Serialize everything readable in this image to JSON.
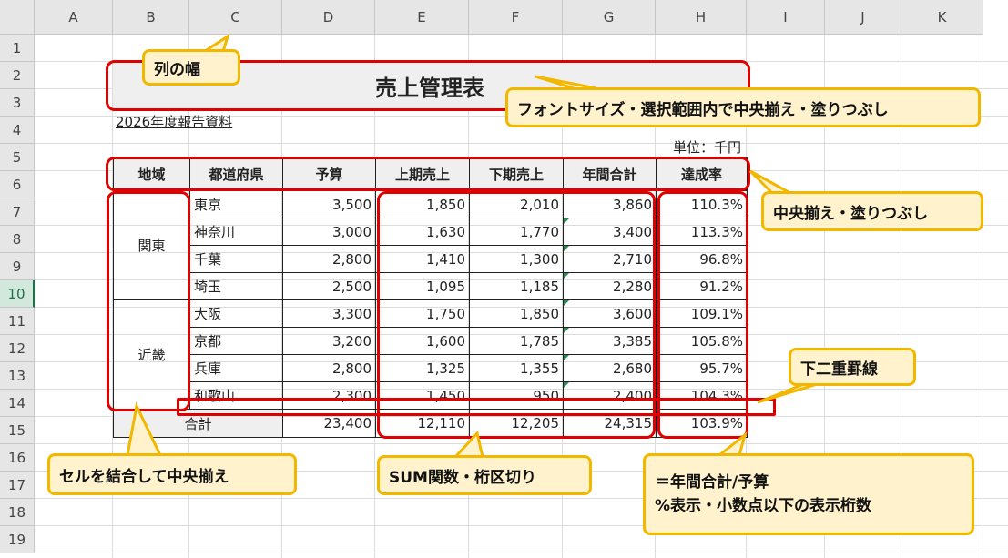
{
  "columns": [
    "A",
    "B",
    "C",
    "D",
    "E",
    "F",
    "G",
    "H",
    "I",
    "J",
    "K"
  ],
  "rows": [
    "1",
    "2",
    "3",
    "4",
    "5",
    "6",
    "7",
    "8",
    "9",
    "10",
    "11",
    "12",
    "13",
    "14",
    "15",
    "16",
    "17",
    "18",
    "19"
  ],
  "selected_row": "10",
  "sheet": {
    "title": "売上管理表",
    "subtitle": "2026年度報告資料",
    "unit": "単位：千円",
    "headers": [
      "地域",
      "都道府県",
      "予算",
      "上期売上",
      "下期売上",
      "年間合計",
      "達成率"
    ],
    "regions": [
      "関東",
      "近畿"
    ],
    "data": [
      [
        "東京",
        "3,500",
        "1,850",
        "2,010",
        "3,860",
        "110.3%"
      ],
      [
        "神奈川",
        "3,000",
        "1,630",
        "1,770",
        "3,400",
        "113.3%"
      ],
      [
        "千葉",
        "2,800",
        "1,410",
        "1,300",
        "2,710",
        "96.8%"
      ],
      [
        "埼玉",
        "2,500",
        "1,095",
        "1,185",
        "2,280",
        "91.2%"
      ],
      [
        "大阪",
        "3,300",
        "1,750",
        "1,850",
        "3,600",
        "109.1%"
      ],
      [
        "京都",
        "3,200",
        "1,600",
        "1,785",
        "3,385",
        "105.8%"
      ],
      [
        "兵庫",
        "2,800",
        "1,325",
        "1,355",
        "2,680",
        "95.7%"
      ],
      [
        "和歌山",
        "2,300",
        "1,450",
        "950",
        "2,400",
        "104.3%"
      ]
    ],
    "total": {
      "label": "合計",
      "budget": "23,400",
      "h1": "12,110",
      "h2": "12,205",
      "annual": "24,315",
      "rate": "103.9%"
    }
  },
  "callouts": {
    "col_width": "列の幅",
    "font_size": "フォントサイズ・選択範囲内で中央揃え・塗りつぶし",
    "center_fill": "中央揃え・塗りつぶし",
    "double_underline": "下二重罫線",
    "merge_center": "セルを結合して中央揃え",
    "sum_func": "SUM関数・桁区切り",
    "formula_line1": "＝年間合計/予算",
    "formula_line2": "%表示・小数点以下の表示桁数"
  },
  "colors": {
    "annotation_red": "#e00000",
    "callout_fill": "#fff2cc",
    "callout_border": "#f2b800",
    "selected_row": "#1e7145"
  }
}
